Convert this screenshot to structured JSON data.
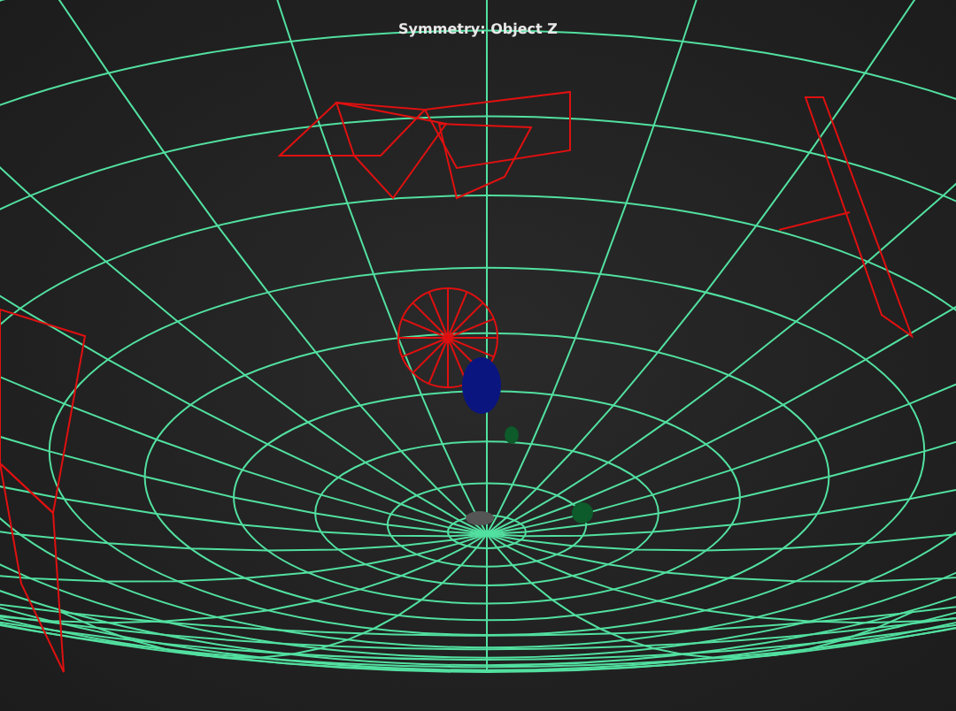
{
  "viewport": {
    "label": "Symmetry: Object Z"
  }
}
